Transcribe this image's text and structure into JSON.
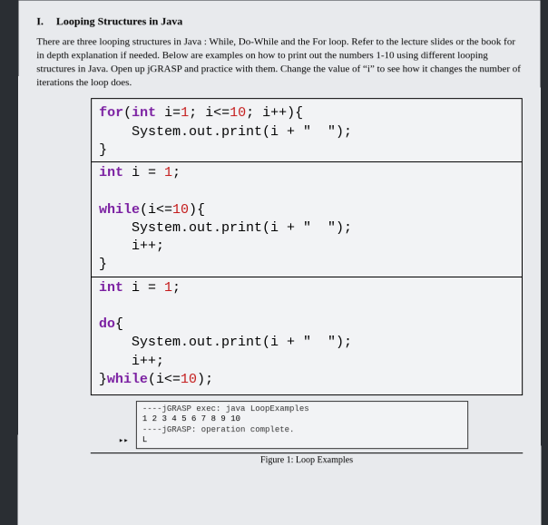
{
  "heading_number": "I.",
  "heading_title": "Looping Structures in Java",
  "intro": "There are three looping structures in Java : While, Do-While and the For loop. Refer to the lecture slides or the book for in depth explanation if needed. Below are examples on how to print out the numbers 1-10 using different looping structures in Java. Open up jGRASP and practice with them. Change the value of “i” to see how it changes the number of iterations the loop does.",
  "code": {
    "for_line1a": "for",
    "for_line1b": "(",
    "for_line1c": "int",
    "for_line1d": " i=",
    "for_line1e": "1",
    "for_line1f": "; i<=",
    "for_line1g": "10",
    "for_line1h": "; i++){",
    "for_line2": "    System.out.print(i + \"  \");",
    "for_line3": "}",
    "decl1a": "int",
    "decl1b": " i = ",
    "decl1c": "1",
    "decl1d": ";",
    "while_line1a": "while",
    "while_line1b": "(i<=",
    "while_line1c": "10",
    "while_line1d": "){",
    "while_line2": "    System.out.print(i + \"  \");",
    "while_line3": "    i++;",
    "while_line4": "}",
    "decl2a": "int",
    "decl2b": " i = ",
    "decl2c": "1",
    "decl2d": ";",
    "do_line1a": "do",
    "do_line1b": "{",
    "do_line2": "    System.out.print(i + \"  \");",
    "do_line3": "    i++;",
    "do_line4a": "}",
    "do_line4b": "while",
    "do_line4c": "(i<=",
    "do_line4d": "10",
    "do_line4e": ");"
  },
  "output": {
    "line1": " ----jGRASP exec: java LoopExamples",
    "line2": "1 2 3 4 5 6 7 8 9 10",
    "line3": " ----jGRASP: operation complete.",
    "cursor": "L",
    "mark": "▸▸"
  },
  "caption": "Figure 1: Loop Examples"
}
